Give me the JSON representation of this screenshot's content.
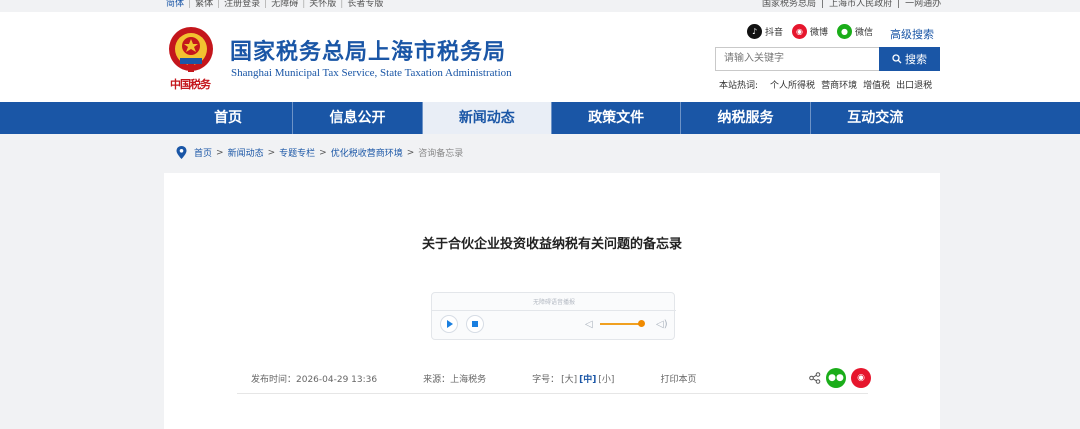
{
  "topbar": {
    "left": [
      "简体",
      "繁体",
      "注册登录",
      "无障碍",
      "关怀版",
      "长者专版"
    ],
    "right": [
      "国家税务总局",
      "上海市人民政府",
      "一网通办"
    ]
  },
  "header": {
    "title": "国家税务总局上海市税务局",
    "subtitle": "Shanghai Municipal Tax Service, State Taxation Administration",
    "slogan": "中国税务",
    "social": [
      "抖音",
      "微博",
      "微信"
    ],
    "advanced_search": "高级搜索",
    "search_placeholder": "请输入关键字",
    "search_button": "搜索",
    "hot_label": "本站热词:",
    "hot_words": [
      "个人所得税",
      "营商环境",
      "增值税",
      "出口退税"
    ]
  },
  "nav": {
    "items": [
      "首页",
      "信息公开",
      "新闻动态",
      "政策文件",
      "纳税服务",
      "互动交流"
    ],
    "active_index": 2
  },
  "breadcrumb": {
    "items": [
      "首页",
      "新闻动态",
      "专题专栏",
      "优化税收营商环境"
    ],
    "current": "咨询备忘录"
  },
  "article": {
    "title": "关于合伙企业投资收益纳税有关问题的备忘录",
    "player_hint": "无障碍语音播报",
    "volume_fraction": 0.8,
    "publish_time": "发布时间：2026-04-29 13:36",
    "source": "来源：上海税务",
    "font_label": "字号：",
    "font_sizes": [
      "[大]",
      "[中]",
      "[小]"
    ],
    "print": "打印本页"
  },
  "colors": {
    "brand": "#1a56a6",
    "wechat": "#1aad19",
    "weibo": "#e6162d",
    "volume": "#f08a00"
  }
}
